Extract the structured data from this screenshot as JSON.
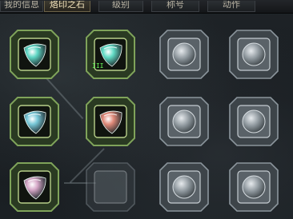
{
  "tabs": [
    {
      "label": "我的信息",
      "active": false
    },
    {
      "label": "烙印之石",
      "active": true
    },
    {
      "label": "级别",
      "active": false
    },
    {
      "label": "称号",
      "active": false
    },
    {
      "label": "动作",
      "active": false
    }
  ],
  "slots": [
    {
      "row": 1,
      "col": 1,
      "state": "filled",
      "gem_color": "#5fd6c4",
      "level": ""
    },
    {
      "row": 1,
      "col": 2,
      "state": "filled",
      "gem_color": "#63dcc6",
      "level": "III"
    },
    {
      "row": 1,
      "col": 3,
      "state": "empty"
    },
    {
      "row": 1,
      "col": 4,
      "state": "empty"
    },
    {
      "row": 2,
      "col": 1,
      "state": "filled",
      "gem_color": "#78c8d8",
      "level": ""
    },
    {
      "row": 2,
      "col": 2,
      "state": "filled",
      "gem_color": "#e08a7a",
      "level": ""
    },
    {
      "row": 2,
      "col": 3,
      "state": "empty"
    },
    {
      "row": 2,
      "col": 4,
      "state": "empty"
    },
    {
      "row": 3,
      "col": 1,
      "state": "filled",
      "gem_color": "#d6a8c8",
      "level": ""
    },
    {
      "row": 3,
      "col": 2,
      "state": "locked"
    },
    {
      "row": 3,
      "col": 3,
      "state": "empty"
    },
    {
      "row": 3,
      "col": 4,
      "state": "empty"
    }
  ]
}
